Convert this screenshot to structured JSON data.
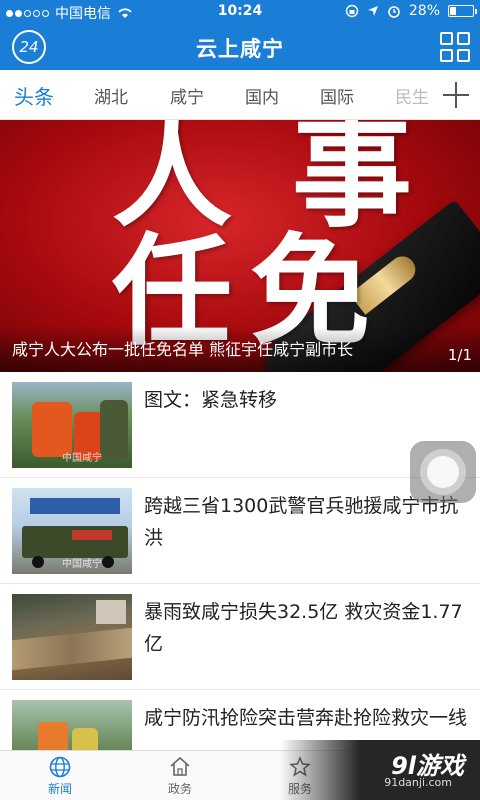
{
  "status_bar": {
    "carrier": "中国电信",
    "time": "10:24",
    "battery": "28%",
    "battery_level": 0.28
  },
  "header": {
    "badge": "24",
    "title": "云上咸宁"
  },
  "tabs": [
    "头条",
    "湖北",
    "咸宁",
    "国内",
    "国际",
    "民生"
  ],
  "banner": {
    "chars": [
      "人",
      "事",
      "任",
      "免"
    ],
    "caption": "咸宁人大公布一批任免名单 熊征宇任咸宁副市长",
    "pager": "1/1"
  },
  "news": [
    {
      "title": "图文：紧急转移",
      "watermark": "中国咸宁"
    },
    {
      "title": "跨越三省1300武警官兵驰援咸宁市抗洪",
      "watermark": "中国咸宁"
    },
    {
      "title": "暴雨致咸宁损失32.5亿 救灾资金1.77亿",
      "watermark": ""
    },
    {
      "title": "咸宁防汛抢险突击营奔赴抢险救灾一线",
      "watermark": ""
    }
  ],
  "bottom_nav": [
    {
      "label": "新闻",
      "icon": "globe-icon"
    },
    {
      "label": "政务",
      "icon": "home-icon"
    },
    {
      "label": "服务",
      "icon": "star-icon"
    }
  ],
  "corner_watermark": {
    "logo": "9l游戏",
    "url": "91danji.com"
  },
  "colors": {
    "brand": "#1a7dd6",
    "banner_red": "#b00d12"
  }
}
